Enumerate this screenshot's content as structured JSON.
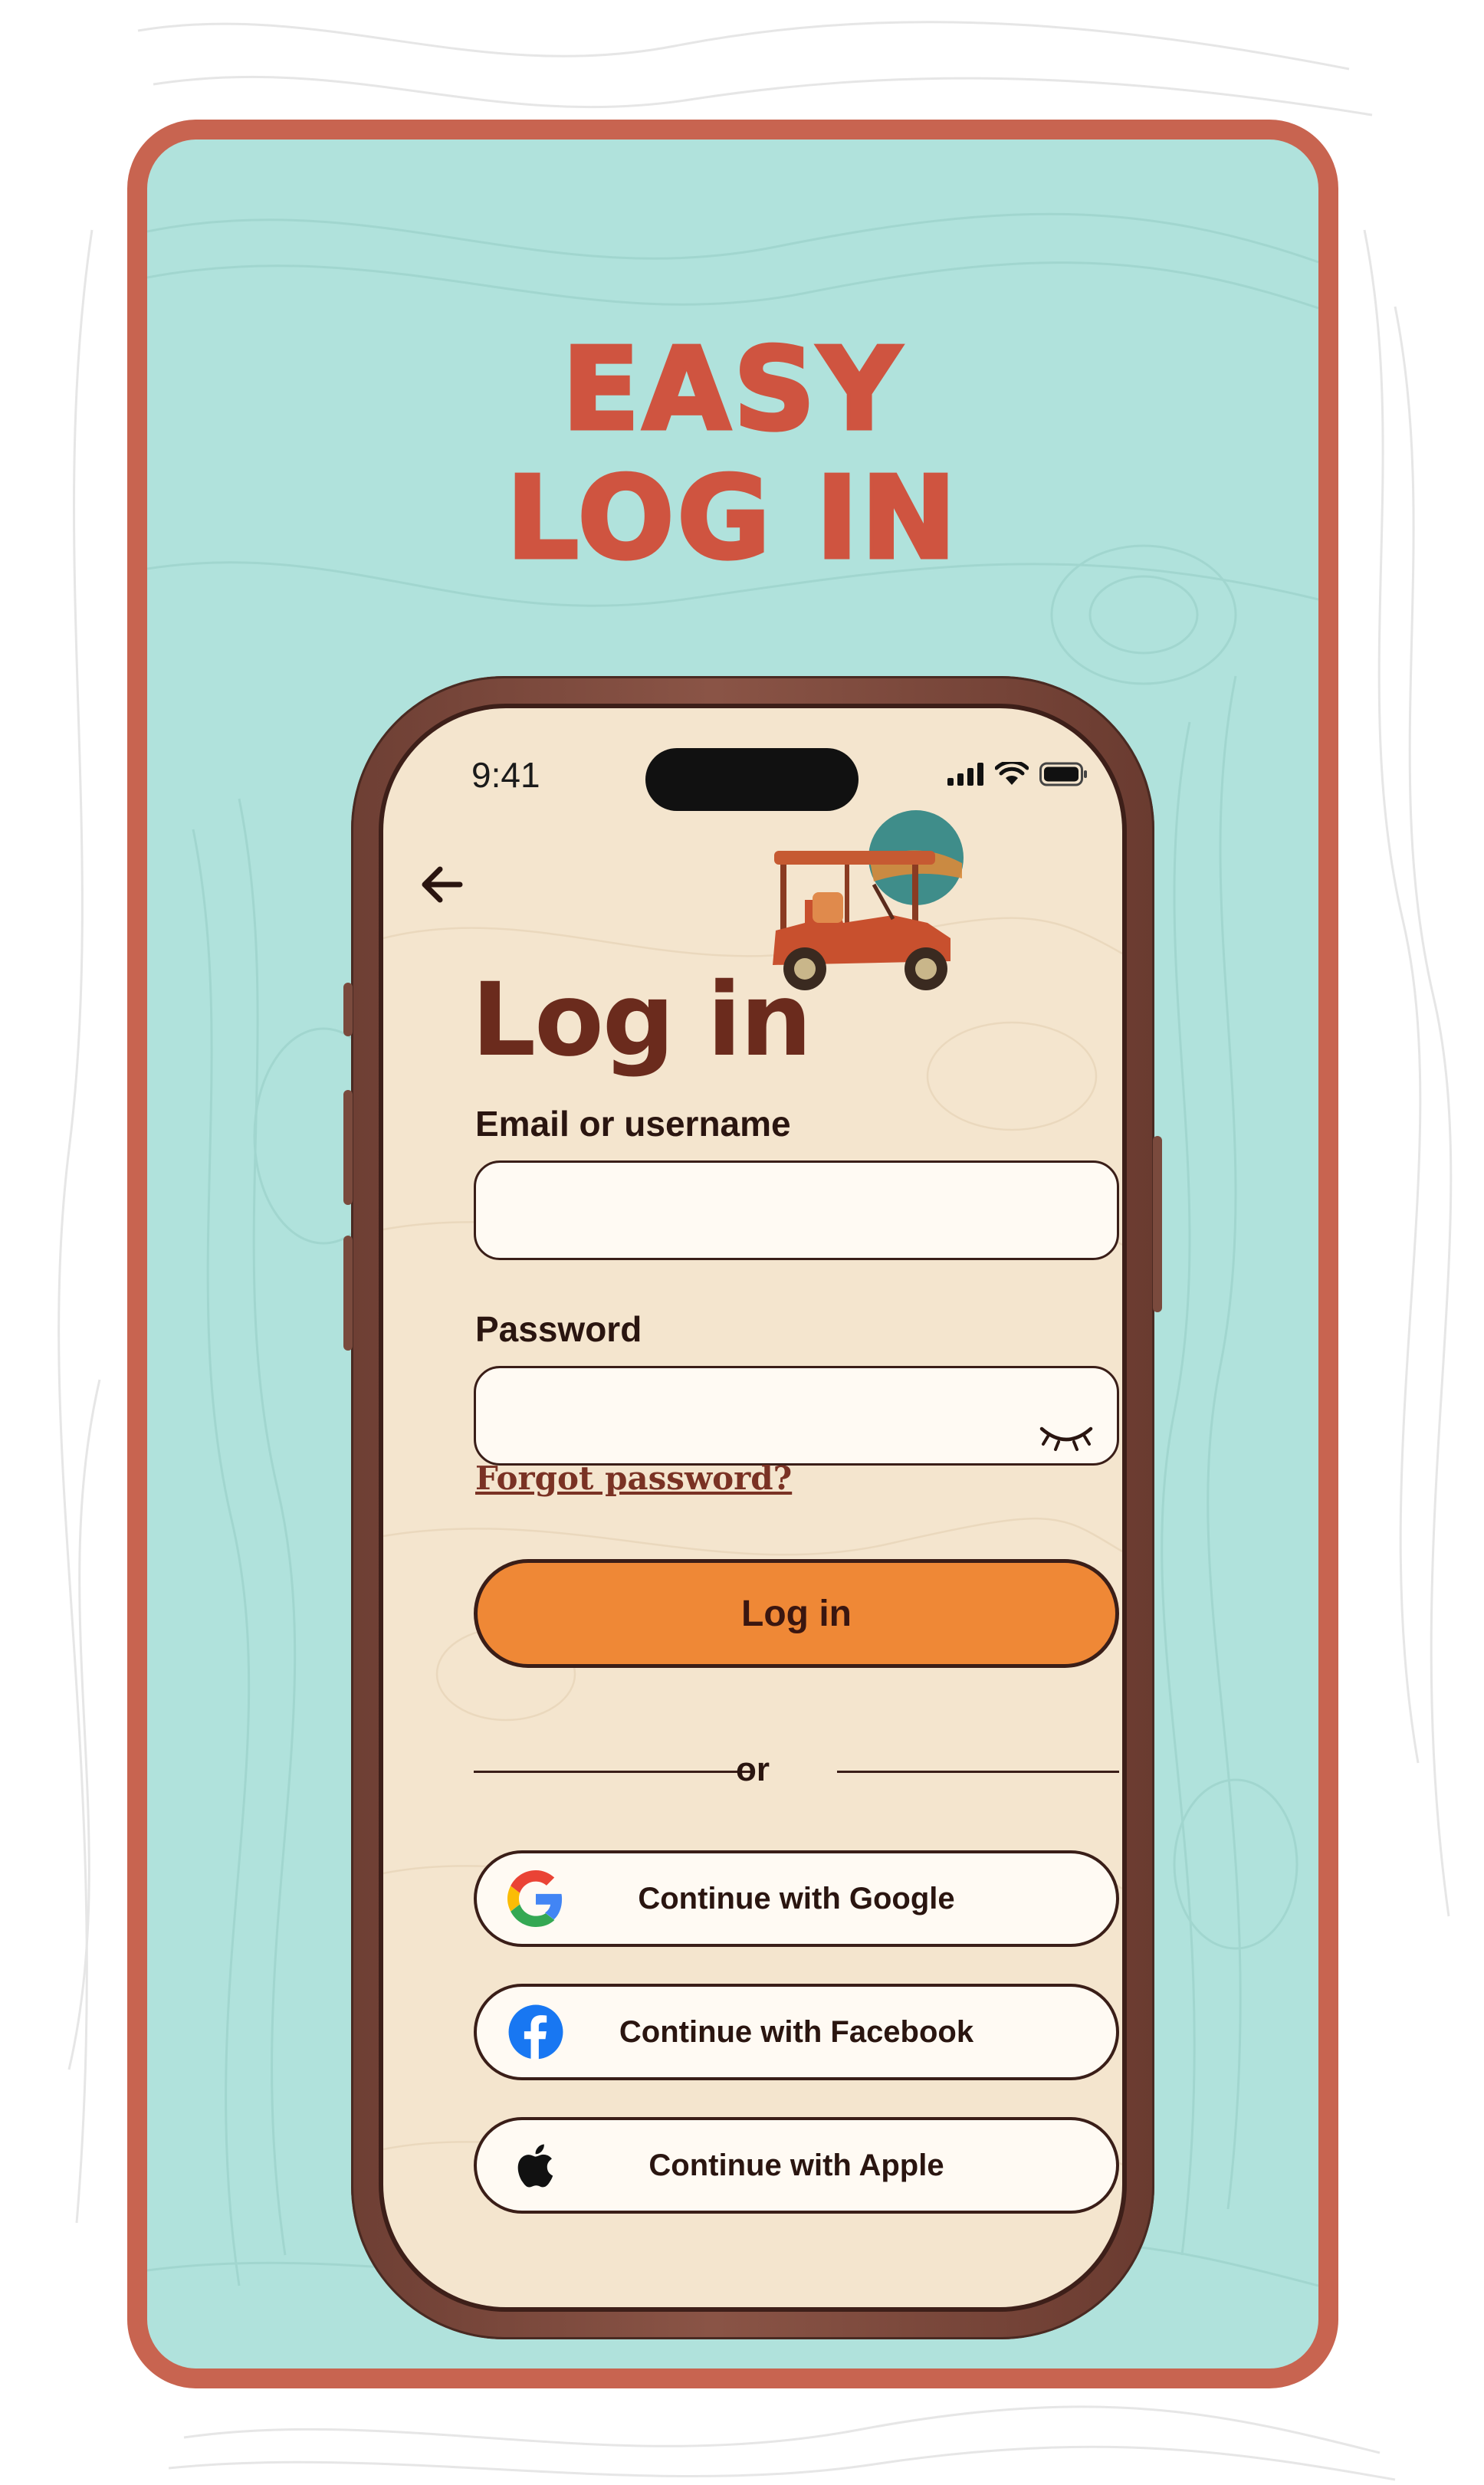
{
  "promo": {
    "headline_line1": "EASY",
    "headline_line2": "LOG IN"
  },
  "status_bar": {
    "time": "9:41"
  },
  "screen": {
    "title": "Log in",
    "email_label": "Email or username",
    "email_value": "",
    "password_label": "Password",
    "password_value": "",
    "forgot_password": "Forgot password?",
    "login_button": "Log in",
    "divider_text": "or",
    "social": {
      "google": "Continue with Google",
      "facebook": "Continue with Facebook",
      "apple": "Continue with Apple"
    }
  },
  "icons": {
    "back": "arrow-left-icon",
    "eye": "eye-closed-icon",
    "google": "google-icon",
    "facebook": "facebook-icon",
    "apple": "apple-icon"
  },
  "colors": {
    "card_border": "#c86450",
    "card_bg": "#b0e2dc",
    "headline": "#cf5440",
    "phone_frame": "#7a4a3d",
    "screen_bg": "#f4e5ce",
    "title": "#6b2b1d",
    "primary_button": "#ef8836",
    "outline": "#3a1e18"
  }
}
